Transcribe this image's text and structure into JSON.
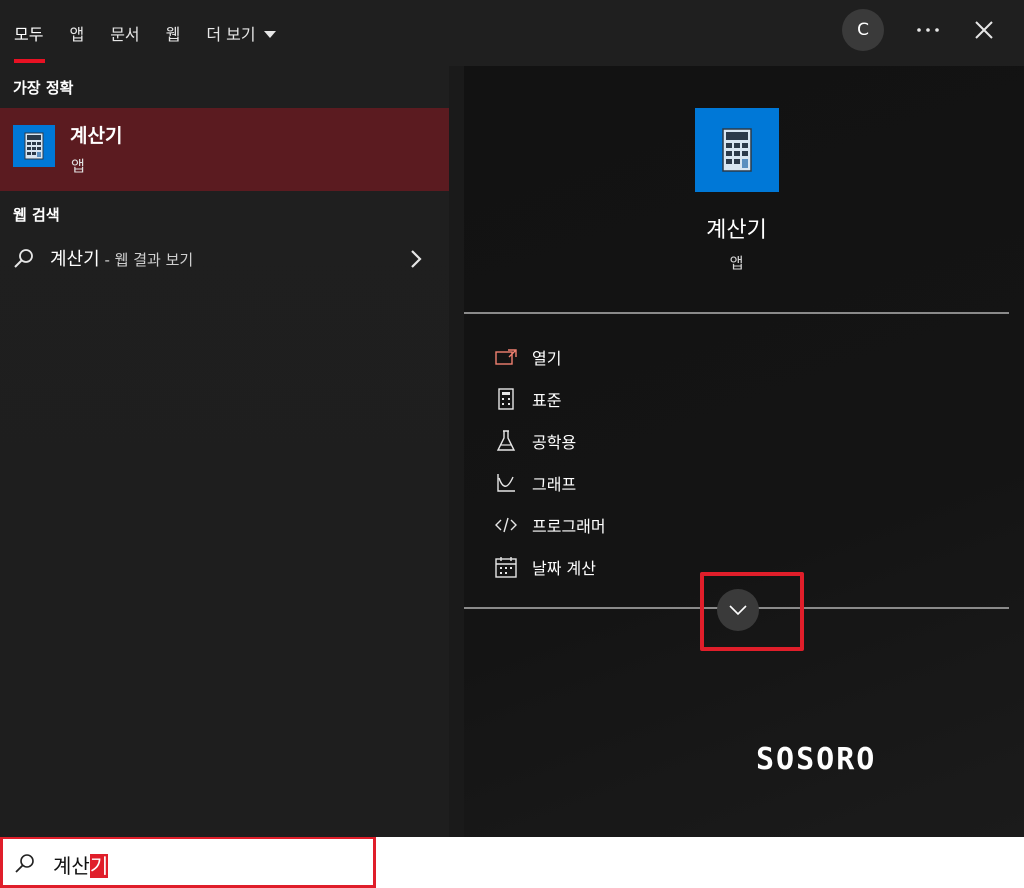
{
  "tabs": [
    {
      "label": "모두",
      "active": true
    },
    {
      "label": "앱"
    },
    {
      "label": "문서"
    },
    {
      "label": "웹"
    },
    {
      "label": "더 보기"
    }
  ],
  "user": {
    "initial": "C"
  },
  "icons": {
    "more": "more-ellipsis-icon",
    "close": "close-icon",
    "calculator": "calculator-icon",
    "search": "search-icon",
    "chevron_right": "chevron-right-icon",
    "expand": "chevron-down-icon"
  },
  "colors": {
    "accent": "#e81123",
    "selection": "#5b1b20",
    "tile": "#0078d7",
    "highlight": "#e01e2a"
  },
  "results": {
    "best_match_heading": "가장 정확",
    "best_match": {
      "title": "계산기",
      "subtitle": "앱"
    },
    "web_heading": "웹 검색",
    "web_item": {
      "query": "계산기",
      "suffix": " - 웹 결과 보기"
    }
  },
  "preview": {
    "app_name": "계산기",
    "app_type": "앱",
    "actions": [
      {
        "label": "열기",
        "icon": "open-window-icon"
      },
      {
        "label": "표준",
        "icon": "calculator-standard-icon"
      },
      {
        "label": "공학용",
        "icon": "flask-icon"
      },
      {
        "label": "그래프",
        "icon": "graph-icon"
      },
      {
        "label": "프로그래머",
        "icon": "code-icon"
      },
      {
        "label": "날짜 계산",
        "icon": "calendar-icon"
      }
    ]
  },
  "watermark": "SOSORO",
  "search": {
    "typed": "계산",
    "selected": "기"
  }
}
